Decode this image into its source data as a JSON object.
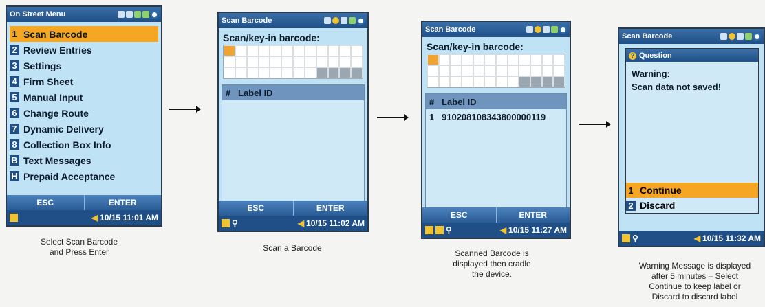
{
  "screens": {
    "menu": {
      "title": "On Street Menu",
      "items": [
        {
          "num": "1",
          "label": "Scan Barcode",
          "selected": true
        },
        {
          "num": "2",
          "label": "Review Entries"
        },
        {
          "num": "3",
          "label": "Settings"
        },
        {
          "num": "4",
          "label": "Firm Sheet"
        },
        {
          "num": "5",
          "label": "Manual Input"
        },
        {
          "num": "6",
          "label": "Change Route"
        },
        {
          "num": "7",
          "label": "Dynamic Delivery"
        },
        {
          "num": "8",
          "label": "Collection Box Info"
        },
        {
          "num": "B",
          "label": "Text Messages"
        },
        {
          "num": "H",
          "label": "Prepaid Acceptance"
        }
      ],
      "esc": "ESC",
      "enter": "ENTER",
      "time": "10/15 11:01 AM"
    },
    "scan1": {
      "title": "Scan Barcode",
      "heading": "Scan/key-in barcode:",
      "col_num": "#",
      "col_label": "Label ID",
      "esc": "ESC",
      "enter": "ENTER",
      "time": "10/15 11:02 AM"
    },
    "scan2": {
      "title": "Scan Barcode",
      "heading": "Scan/key-in barcode:",
      "col_num": "#",
      "col_label": "Label ID",
      "row_num": "1",
      "row_label": "910208108343800000119",
      "esc": "ESC",
      "enter": "ENTER",
      "time": "10/15 11:27 AM"
    },
    "warning": {
      "title": "Scan Barcode",
      "dialog_title": "Question",
      "warning": "Warning:",
      "message": "Scan data not saved!",
      "opt1_num": "1",
      "opt1": "Continue",
      "opt2_num": "2",
      "opt2": "Discard",
      "time": "10/15 11:32 AM"
    }
  },
  "captions": {
    "c1a": "Select Scan Barcode",
    "c1b": "and Press Enter",
    "c2": "Scan a Barcode",
    "c3a": "Scanned Barcode is",
    "c3b": "displayed then cradle",
    "c3c": "the device.",
    "c4a": "Warning Message is displayed",
    "c4b": "after 5 minutes – Select",
    "c4c": "Continue to keep label or",
    "c4d": "Discard to discard label"
  },
  "colors": {
    "accent": "#f5a623",
    "titlebar": "#1f4f86",
    "screen_bg": "#bfe3f4"
  }
}
